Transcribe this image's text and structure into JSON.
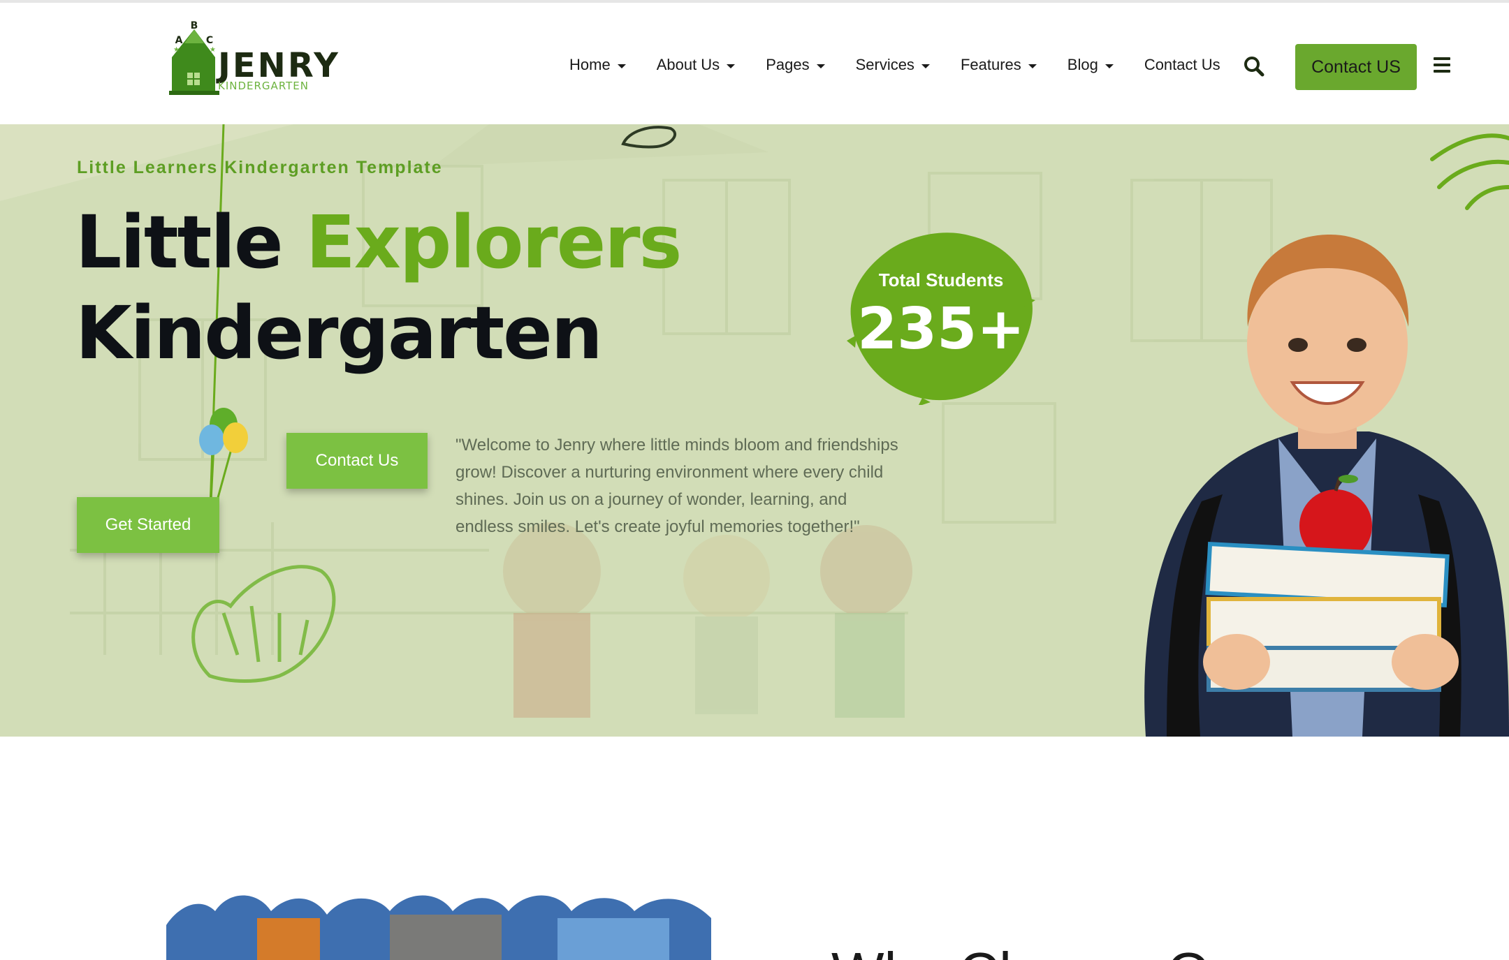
{
  "brand": {
    "name": "JENRY",
    "tagline": "KINDERGARTEN",
    "logo_letters": [
      "A",
      "B",
      "C"
    ],
    "primary_color": "#6aa82e",
    "dark_color": "#1d2b12"
  },
  "nav": {
    "items": [
      {
        "label": "Home",
        "has_dropdown": true
      },
      {
        "label": "About Us",
        "has_dropdown": true
      },
      {
        "label": "Pages",
        "has_dropdown": true
      },
      {
        "label": "Services",
        "has_dropdown": true
      },
      {
        "label": "Features",
        "has_dropdown": true
      },
      {
        "label": "Blog",
        "has_dropdown": true
      },
      {
        "label": "Contact Us",
        "has_dropdown": false
      }
    ],
    "search_icon": "search-icon",
    "cta_label": "Contact US",
    "menu_icon": "hamburger-icon"
  },
  "hero": {
    "subtitle": "Little Learners Kindergarten Template",
    "title_word1": "Little",
    "title_word2": "Explorers",
    "title_line2": "Kindergarten",
    "contact_button": "Contact Us",
    "start_button": "Get Started",
    "intro": "\"Welcome to Jenry where little minds bloom and friendships grow! Discover a nurturing environment where every child shines. Join us on a journey of wonder, learning, and endless smiles. Let's create joyful memories together!\"",
    "stat_label": "Total Students",
    "stat_value": "235+",
    "background_color": "#d2ddb7",
    "accent_color": "#7cc142"
  },
  "section2": {
    "heading": "Why Choose Our"
  }
}
